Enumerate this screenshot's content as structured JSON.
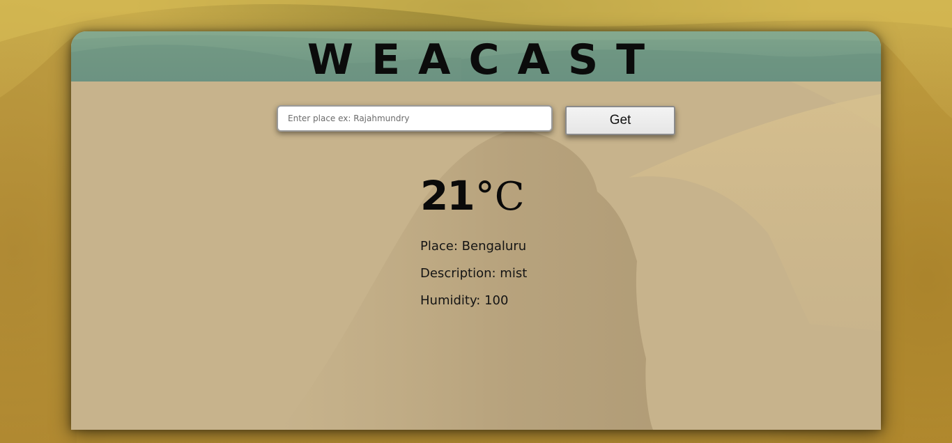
{
  "app": {
    "title": "WEACAST"
  },
  "search": {
    "placeholder": "Enter place ex: Rajahmundry",
    "value": "",
    "button_label": "Get"
  },
  "weather": {
    "temperature_value": "21",
    "temperature_unit": "°C",
    "place_line": "Place: Bengaluru",
    "description_line": "Description: mist",
    "humidity_line": "Humidity: 100"
  },
  "colors": {
    "header": "#739a86",
    "card": "#c6b28a",
    "background": "#c4a244",
    "button": "#eeeeee"
  }
}
